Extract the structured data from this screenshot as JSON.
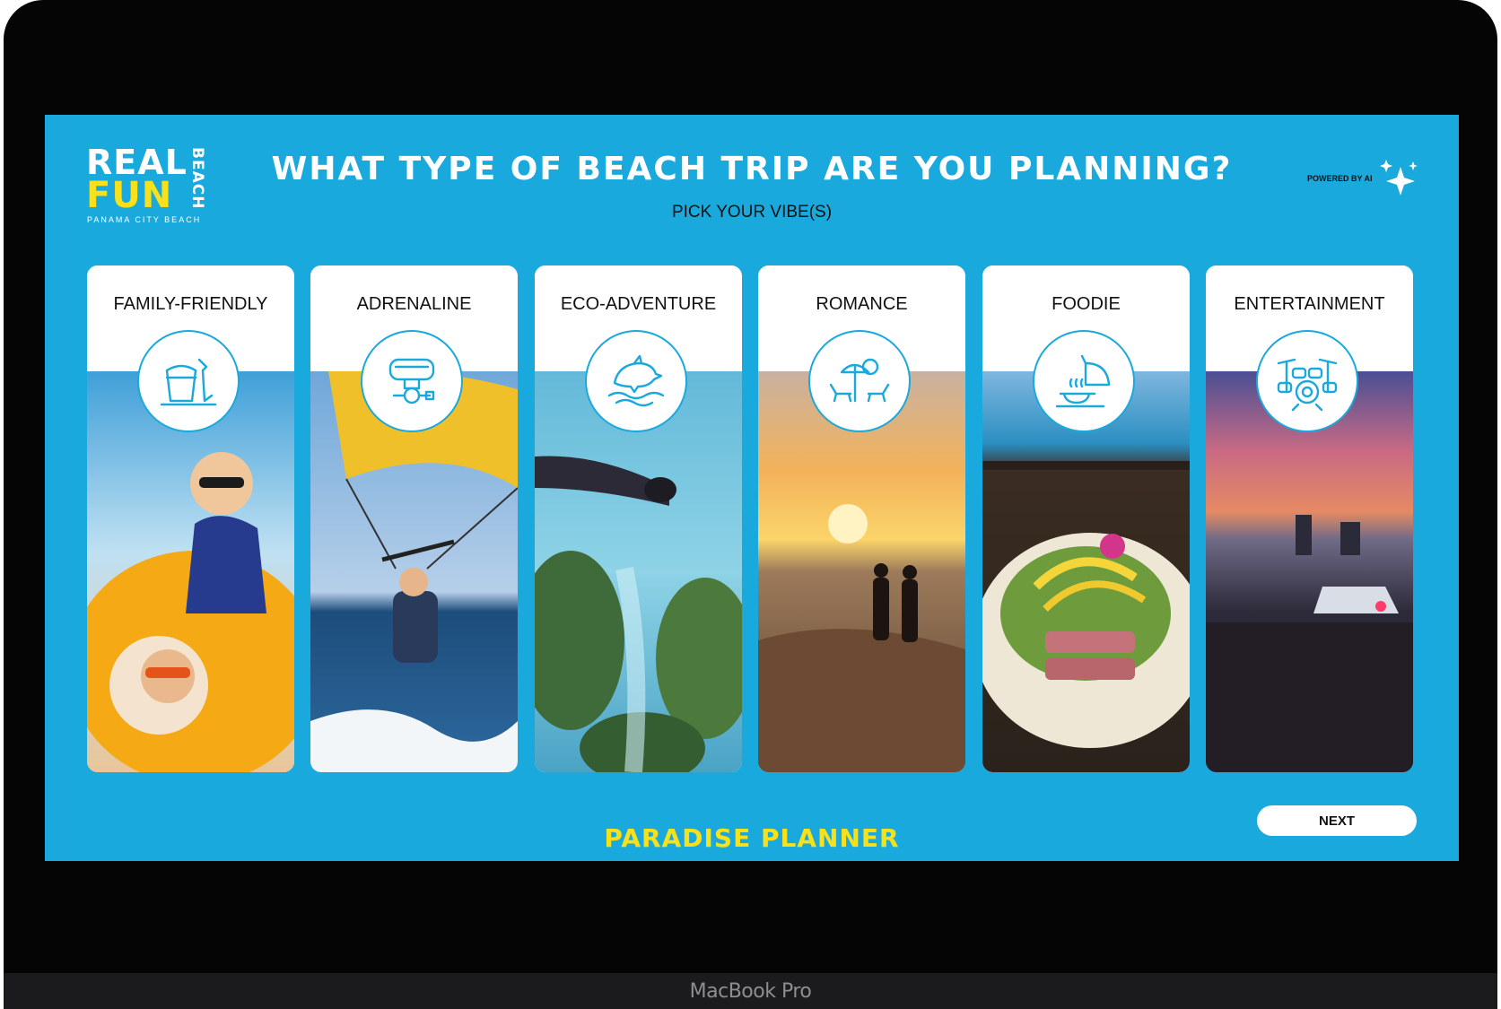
{
  "device": {
    "label": "MacBook Pro"
  },
  "logo": {
    "line1": "REAL",
    "line2": "FUN",
    "vertical": "BEACH",
    "subtitle": "PANAMA CITY BEACH"
  },
  "header": {
    "title": "WHAT TYPE OF BEACH TRIP ARE YOU PLANNING?",
    "subtitle": "PICK YOUR VIBE(S)",
    "powered_by": "POWERED BY AI",
    "sparkle_icon": "sparkle-icon"
  },
  "cards": [
    {
      "label": "FAMILY-FRIENDLY",
      "icon": "sand-bucket-icon"
    },
    {
      "label": "ADRENALINE",
      "icon": "dive-mask-icon"
    },
    {
      "label": "ECO-ADVENTURE",
      "icon": "dolphin-icon"
    },
    {
      "label": "ROMANCE",
      "icon": "beach-loungers-icon"
    },
    {
      "label": "FOODIE",
      "icon": "serving-cloche-icon"
    },
    {
      "label": "ENTERTAINMENT",
      "icon": "drum-kit-icon"
    }
  ],
  "actions": {
    "next_label": "NEXT"
  },
  "footer": {
    "brand": "PARADISE PLANNER"
  },
  "colors": {
    "background": "#1aa9dc",
    "accent": "#f7e11a"
  }
}
